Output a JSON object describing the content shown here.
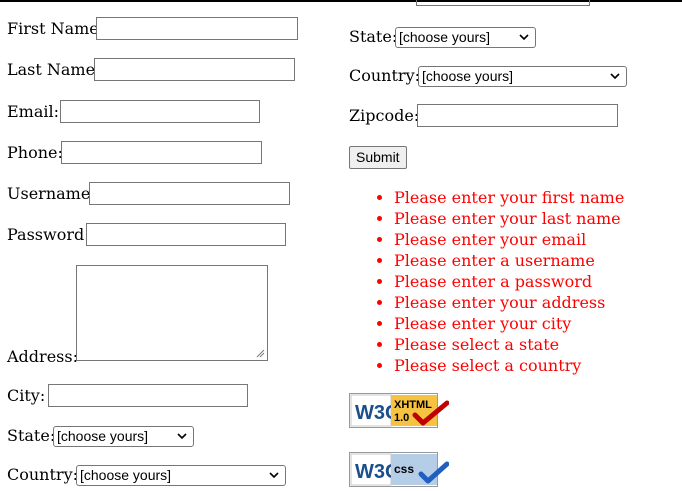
{
  "left_form": {
    "first_name_label": "First Name:",
    "last_name_label": "Last Name:",
    "email_label": "Email:",
    "phone_label": "Phone:",
    "username_label": "Username:",
    "password_label": "Password:",
    "address_label": "Address:",
    "city_label": "City:",
    "state_label": "State:",
    "state_value": "[choose yours]",
    "country_label": "Country:",
    "country_value": "[choose yours]"
  },
  "right_form": {
    "state_label": "State:",
    "state_value": "[choose yours]",
    "country_label": "Country:",
    "country_value": "[choose yours]",
    "zipcode_label": "Zipcode:",
    "submit_label": "Submit"
  },
  "errors": [
    "Please enter your first name",
    "Please enter your last name",
    "Please enter your email",
    "Please enter a username",
    "Please enter a password",
    "Please enter your address",
    "Please enter your city",
    "Please select a state",
    "Please select a country"
  ],
  "badges": {
    "xhtml": {
      "w3c": "W3C",
      "text1": "XHTML",
      "text2": "1.0"
    },
    "css": {
      "w3c": "W3C",
      "text": "css"
    }
  },
  "colors": {
    "error": "#ff0000",
    "check_red": "#c00000",
    "check_blue": "#1f5fbf"
  }
}
